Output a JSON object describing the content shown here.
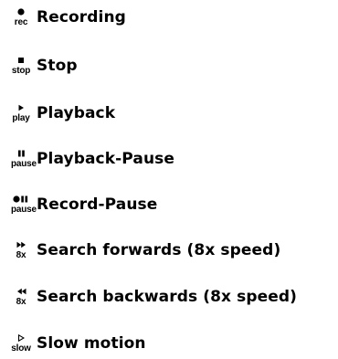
{
  "legend": {
    "items": [
      {
        "icon": "record-dot-icon",
        "caption": "rec",
        "label": "Recording"
      },
      {
        "icon": "stop-square-icon",
        "caption": "stop",
        "label": "Stop"
      },
      {
        "icon": "play-triangle-icon",
        "caption": "play",
        "label": "Playback"
      },
      {
        "icon": "pause-bars-icon",
        "caption": "pause",
        "label": "Playback-Pause"
      },
      {
        "icon": "record-pause-icon",
        "caption": "pause",
        "label": "Record-Pause"
      },
      {
        "icon": "fast-forward-icon",
        "caption": "8x",
        "label": "Search forwards (8x speed)"
      },
      {
        "icon": "rewind-icon",
        "caption": "8x",
        "label": "Search backwards (8x speed)"
      },
      {
        "icon": "slow-motion-icon",
        "caption": "slow",
        "label": "Slow motion"
      }
    ]
  }
}
